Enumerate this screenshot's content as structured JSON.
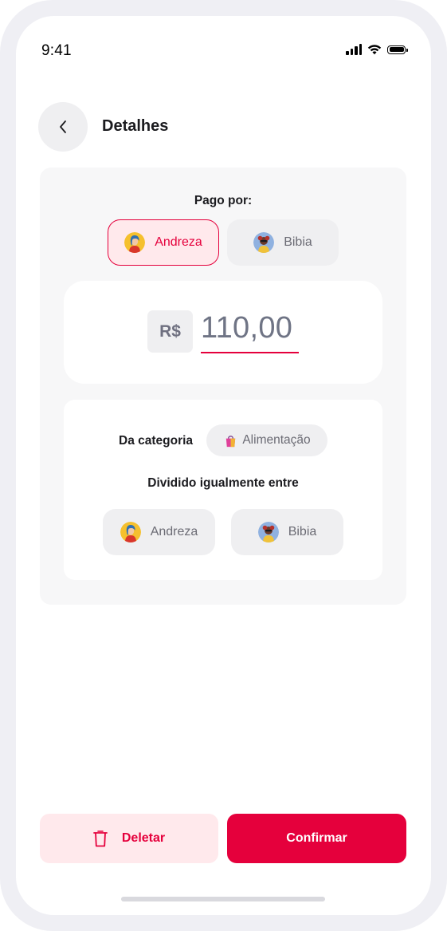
{
  "status_bar": {
    "time": "9:41"
  },
  "header": {
    "back_icon": "chevron-left-icon",
    "title": "Detalhes"
  },
  "paid_by": {
    "label": "Pago por:",
    "options": [
      {
        "name": "Andreza",
        "selected": true
      },
      {
        "name": "Bibia",
        "selected": false
      }
    ]
  },
  "amount": {
    "currency": "R$",
    "value": "110,00"
  },
  "category": {
    "label": "Da categoria",
    "emoji": "🛍️",
    "name": "Alimentação"
  },
  "split": {
    "label": "Dividido igualmente entre",
    "people": [
      {
        "name": "Andreza"
      },
      {
        "name": "Bibia"
      }
    ]
  },
  "actions": {
    "delete_label": "Deletar",
    "delete_icon": "trash-icon",
    "confirm_label": "Confirmar"
  },
  "colors": {
    "accent": "#e5003c",
    "accent_light": "#ffe9ec",
    "chip_bg": "#efeff1",
    "card_bg": "#f7f7f8",
    "frame": "#efeff4"
  }
}
